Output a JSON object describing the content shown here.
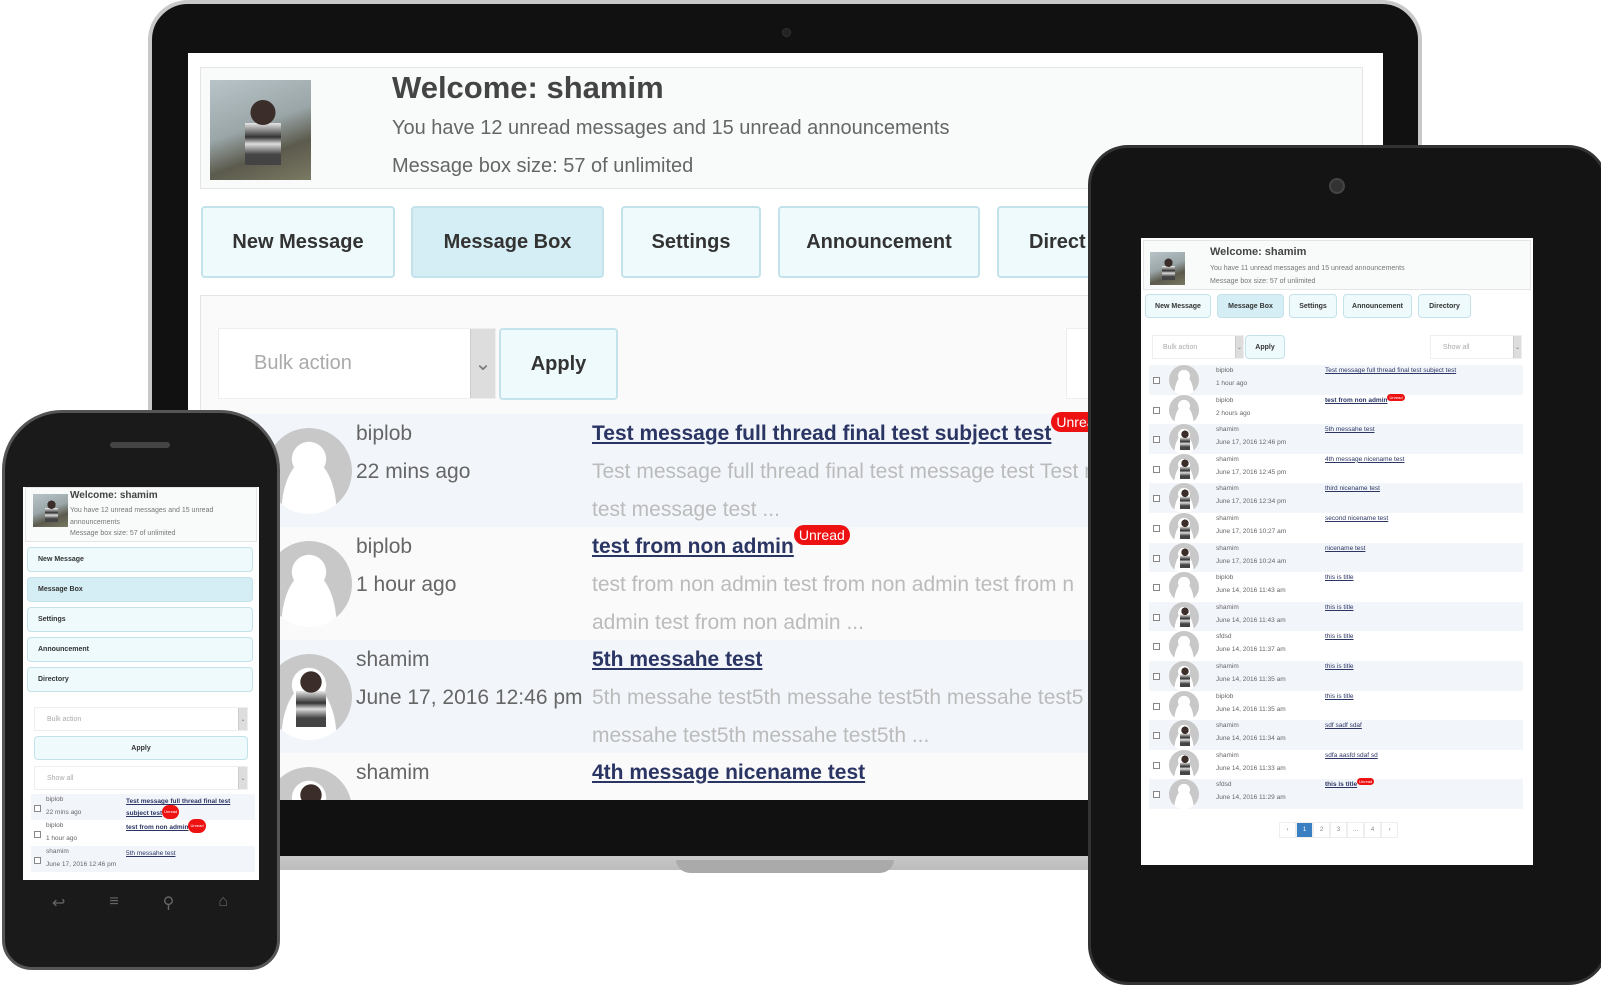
{
  "colors": {
    "accent": "#d5edf4",
    "button_bg": "#effafd",
    "unread_badge": "#ee1111",
    "link": "#2b3563",
    "pagination_active": "#3a7fc1"
  },
  "nav": [
    "New Message",
    "Message Box",
    "Settings",
    "Announcement",
    "Directory"
  ],
  "controls": {
    "bulk": "Bulk action",
    "apply": "Apply",
    "show": "Show all",
    "dropdown_icon": "chevron-down-icon"
  },
  "badge": "Unread",
  "laptop": {
    "welcome": "Welcome: shamim",
    "unread": "You have 12 unread messages and 15 unread announcements",
    "size": "Message box size: 57 of unlimited",
    "nav_visible": [
      "New Message",
      "Message Box",
      "Settings",
      "Announcement",
      "Direct"
    ],
    "rows": [
      {
        "name": "biplob",
        "time": "22 mins ago",
        "subject": "Test message full thread final test subject test",
        "unread": true,
        "excerpt": "Test message full thread final test message test Test m",
        "excerpt2": "test message test ...",
        "avatar": "default"
      },
      {
        "name": "biplob",
        "time": "1 hour ago",
        "subject": "test from non admin",
        "unread": true,
        "excerpt": "test from non admin test from non admin test from n",
        "excerpt2": "admin test from non admin ...",
        "avatar": "default"
      },
      {
        "name": "shamim",
        "time": "June 17, 2016 12:46 pm",
        "subject": "5th messahe test",
        "unread": false,
        "excerpt": "5th messahe test5th messahe test5th messahe test5",
        "excerpt2": "messahe test5th messahe test5th ...",
        "avatar": "photo"
      },
      {
        "name": "shamim",
        "time": "",
        "subject": "4th message nicename test",
        "unread": false,
        "excerpt": "",
        "excerpt2": "",
        "avatar": "photo"
      }
    ]
  },
  "tablet": {
    "welcome": "Welcome: shamim",
    "unread": "You have 11 unread messages and 15 unread announcements",
    "size": "Message box size: 57 of unlimited",
    "rows": [
      {
        "name": "biplob",
        "time": "1 hour ago",
        "subject": "Test message full thread final test subject test",
        "unread": false,
        "avatar": "default"
      },
      {
        "name": "biplob",
        "time": "2 hours ago",
        "subject": "test from non admin",
        "unread": true,
        "avatar": "default"
      },
      {
        "name": "shamim",
        "time": "June 17, 2016 12:46 pm",
        "subject": "5th messahe test",
        "unread": false,
        "avatar": "photo"
      },
      {
        "name": "shamim",
        "time": "June 17, 2016 12:45 pm",
        "subject": "4th message nicename test",
        "unread": false,
        "avatar": "photo"
      },
      {
        "name": "shamim",
        "time": "June 17, 2016 12:34 pm",
        "subject": "third nicename test",
        "unread": false,
        "avatar": "photo"
      },
      {
        "name": "shamim",
        "time": "June 17, 2016 10:27 am",
        "subject": "second nicename test",
        "unread": false,
        "avatar": "photo"
      },
      {
        "name": "shamim",
        "time": "June 17, 2016 10:24 am",
        "subject": "nicename test",
        "unread": false,
        "avatar": "photo"
      },
      {
        "name": "biplob",
        "time": "June 14, 2016 11:43 am",
        "subject": "this is title",
        "unread": false,
        "avatar": "default"
      },
      {
        "name": "shamim",
        "time": "June 14, 2016 11:43 am",
        "subject": "this is title",
        "unread": false,
        "avatar": "photo"
      },
      {
        "name": "sfdsd",
        "time": "June 14, 2016 11:37 am",
        "subject": "this is title",
        "unread": false,
        "avatar": "default"
      },
      {
        "name": "shamim",
        "time": "June 14, 2016 11:35 am",
        "subject": "this is title",
        "unread": false,
        "avatar": "photo"
      },
      {
        "name": "biplob",
        "time": "June 14, 2016 11:35 am",
        "subject": "this is title",
        "unread": false,
        "avatar": "default"
      },
      {
        "name": "shamim",
        "time": "June 14, 2016 11:34 am",
        "subject": "sdf sadf sdaf",
        "unread": false,
        "avatar": "photo"
      },
      {
        "name": "shamim",
        "time": "June 14, 2016 11:33 am",
        "subject": "sdfa aasfd sdaf sd",
        "unread": false,
        "avatar": "photo"
      },
      {
        "name": "sfdsd",
        "time": "June 14, 2016 11:29 am",
        "subject": "this is title",
        "unread": true,
        "avatar": "default"
      }
    ],
    "pagination": [
      "‹",
      "1",
      "2",
      "3",
      "…",
      "4",
      "›"
    ],
    "current_page": "1"
  },
  "phone": {
    "welcome": "Welcome: shamim",
    "unread": "You have 12 unread messages and 15 unread announcements",
    "size": "Message box size: 57 of unlimited",
    "rows": [
      {
        "name": "biplob",
        "time": "22 mins ago",
        "subject": "Test message full thread final test subject test",
        "unread": true
      },
      {
        "name": "biplob",
        "time": "1 hour ago",
        "subject": "test from non admin",
        "unread": true
      },
      {
        "name": "shamim",
        "time": "June 17, 2016 12:46 pm",
        "subject": "5th messahe test",
        "unread": false
      }
    ],
    "keys": [
      "back-icon",
      "menu-icon",
      "search-icon",
      "home-icon"
    ]
  }
}
